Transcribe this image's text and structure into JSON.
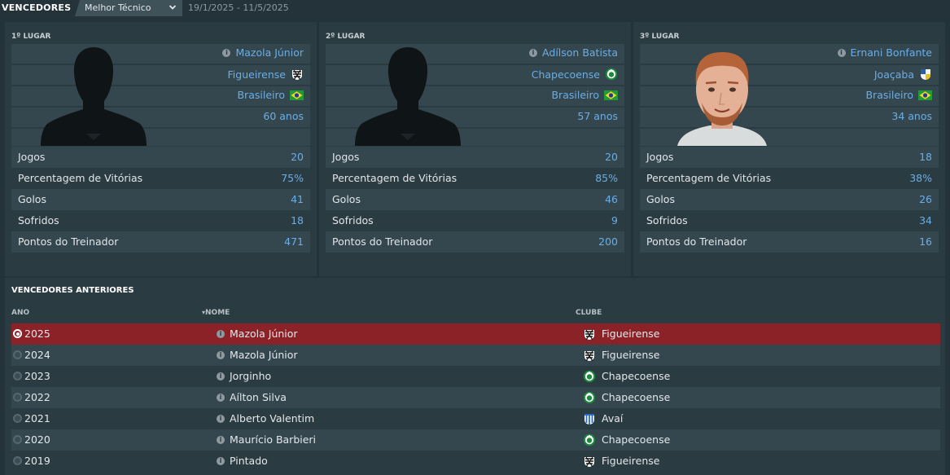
{
  "header": {
    "title": "VENCEDORES",
    "award_selected": "Melhor Técnico",
    "date_range": "19/1/2025 - 11/5/2025"
  },
  "podium": [
    {
      "place": "1º LUGAR",
      "name": "Mazola Júnior",
      "club": "Figueirense",
      "nationality": "Brasileiro",
      "age": "60 anos",
      "stats": [
        {
          "label": "Jogos",
          "value": "20"
        },
        {
          "label": "Percentagem de Vitórias",
          "value": "75%"
        },
        {
          "label": "Golos",
          "value": "41"
        },
        {
          "label": "Sofridos",
          "value": "18"
        },
        {
          "label": "Pontos do Treinador",
          "value": "471"
        }
      ]
    },
    {
      "place": "2º LUGAR",
      "name": "Adílson Batista",
      "club": "Chapecoense",
      "nationality": "Brasileiro",
      "age": "57 anos",
      "stats": [
        {
          "label": "Jogos",
          "value": "20"
        },
        {
          "label": "Percentagem de Vitórias",
          "value": "85%"
        },
        {
          "label": "Golos",
          "value": "46"
        },
        {
          "label": "Sofridos",
          "value": "9"
        },
        {
          "label": "Pontos do Treinador",
          "value": "200"
        }
      ]
    },
    {
      "place": "3º LUGAR",
      "name": "Ernani Bonfante",
      "club": "Joaçaba",
      "nationality": "Brasileiro",
      "age": "34 anos",
      "stats": [
        {
          "label": "Jogos",
          "value": "18"
        },
        {
          "label": "Percentagem de Vitórias",
          "value": "38%"
        },
        {
          "label": "Golos",
          "value": "26"
        },
        {
          "label": "Sofridos",
          "value": "34"
        },
        {
          "label": "Pontos do Treinador",
          "value": "16"
        }
      ]
    }
  ],
  "previous": {
    "title": "VENCEDORES ANTERIORES",
    "columns": {
      "year": "ANO",
      "name": "NOME",
      "club": "CLUBE"
    },
    "rows": [
      {
        "year": "2025",
        "name": "Mazola Júnior",
        "club": "Figueirense",
        "badge": "figueirense"
      },
      {
        "year": "2024",
        "name": "Mazola Júnior",
        "club": "Figueirense",
        "badge": "figueirense"
      },
      {
        "year": "2023",
        "name": "Jorginho",
        "club": "Chapecoense",
        "badge": "chapecoense"
      },
      {
        "year": "2022",
        "name": "Aílton Silva",
        "club": "Chapecoense",
        "badge": "chapecoense"
      },
      {
        "year": "2021",
        "name": "Alberto Valentim",
        "club": "Avaí",
        "badge": "avai"
      },
      {
        "year": "2020",
        "name": "Maurício Barbieri",
        "club": "Chapecoense",
        "badge": "chapecoense"
      },
      {
        "year": "2019",
        "name": "Pintado",
        "club": "Figueirense",
        "badge": "figueirense"
      }
    ]
  },
  "colors": {
    "background": "#243239",
    "panel": "#2b3b42",
    "link": "#6aaee6",
    "selected_row": "#8b2228"
  }
}
